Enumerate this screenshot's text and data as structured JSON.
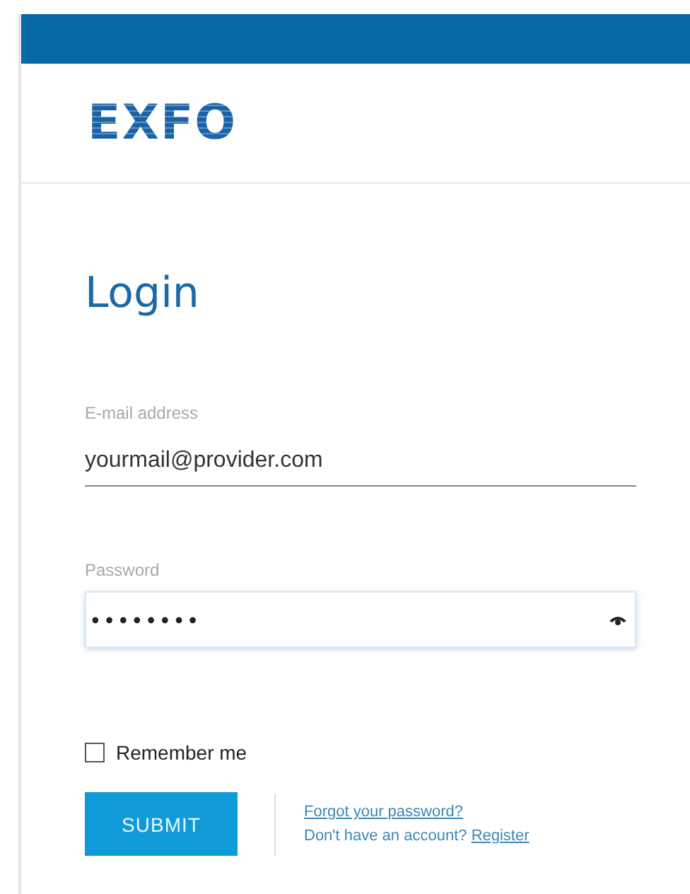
{
  "logo": {
    "text": "EXFO"
  },
  "title": "Login",
  "email": {
    "label": "E-mail address",
    "value": "yourmail@provider.com"
  },
  "password": {
    "label": "Password",
    "value": "••••••••",
    "focused": true
  },
  "remember": {
    "label": "Remember me",
    "checked": false
  },
  "submit": {
    "label": "SUBMIT"
  },
  "links": {
    "forgot": "Forgot your password?",
    "no_account": "Don't have an account?",
    "register": "Register"
  }
}
